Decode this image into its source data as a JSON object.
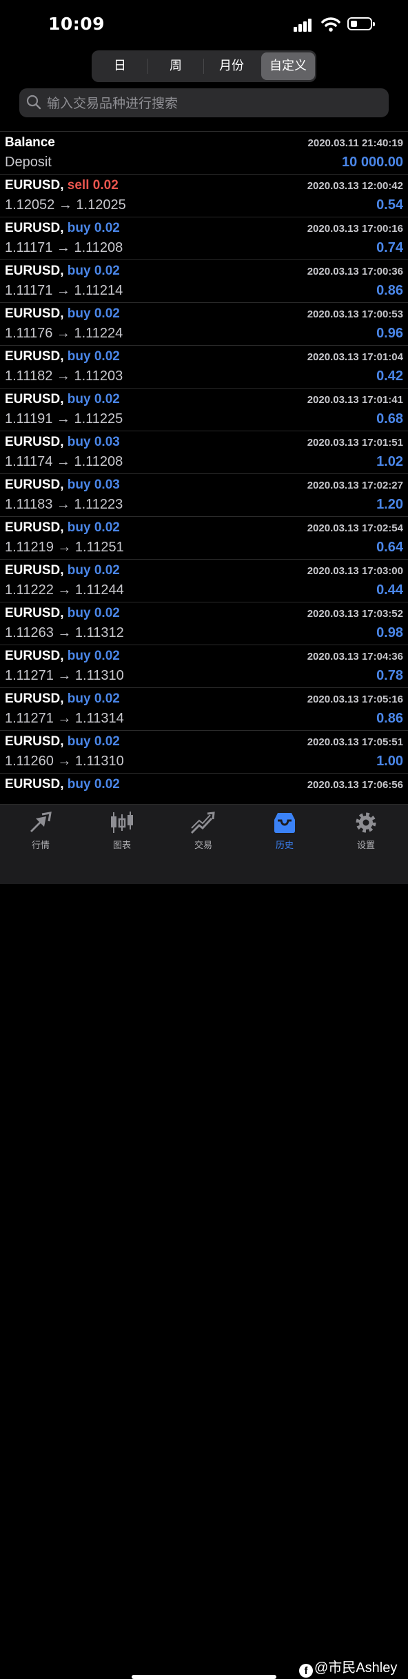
{
  "status_bar": {
    "time": "10:09"
  },
  "periods": {
    "tabs": [
      "日",
      "周",
      "月份",
      "自定义"
    ],
    "selected": "自定义"
  },
  "search": {
    "placeholder": "输入交易品种进行搜索"
  },
  "history": [
    {
      "symbol": "Balance",
      "action": "",
      "volume": "",
      "datetime": "2020.03.11 21:40:19",
      "prices": "Deposit",
      "profit": "10 000.00"
    },
    {
      "symbol": "EURUSD,",
      "action": "sell",
      "volume": "0.02",
      "datetime": "2020.03.13 12:00:42",
      "prices": "1.12052 → 1.12025",
      "profit": "0.54"
    },
    {
      "symbol": "EURUSD,",
      "action": "buy",
      "volume": "0.02",
      "datetime": "2020.03.13 17:00:16",
      "prices": "1.11171 → 1.11208",
      "profit": "0.74"
    },
    {
      "symbol": "EURUSD,",
      "action": "buy",
      "volume": "0.02",
      "datetime": "2020.03.13 17:00:36",
      "prices": "1.11171 → 1.11214",
      "profit": "0.86"
    },
    {
      "symbol": "EURUSD,",
      "action": "buy",
      "volume": "0.02",
      "datetime": "2020.03.13 17:00:53",
      "prices": "1.11176 → 1.11224",
      "profit": "0.96"
    },
    {
      "symbol": "EURUSD,",
      "action": "buy",
      "volume": "0.02",
      "datetime": "2020.03.13 17:01:04",
      "prices": "1.11182 → 1.11203",
      "profit": "0.42"
    },
    {
      "symbol": "EURUSD,",
      "action": "buy",
      "volume": "0.02",
      "datetime": "2020.03.13 17:01:41",
      "prices": "1.11191 → 1.11225",
      "profit": "0.68"
    },
    {
      "symbol": "EURUSD,",
      "action": "buy",
      "volume": "0.03",
      "datetime": "2020.03.13 17:01:51",
      "prices": "1.11174 → 1.11208",
      "profit": "1.02"
    },
    {
      "symbol": "EURUSD,",
      "action": "buy",
      "volume": "0.03",
      "datetime": "2020.03.13 17:02:27",
      "prices": "1.11183 → 1.11223",
      "profit": "1.20"
    },
    {
      "symbol": "EURUSD,",
      "action": "buy",
      "volume": "0.02",
      "datetime": "2020.03.13 17:02:54",
      "prices": "1.11219 → 1.11251",
      "profit": "0.64"
    },
    {
      "symbol": "EURUSD,",
      "action": "buy",
      "volume": "0.02",
      "datetime": "2020.03.13 17:03:00",
      "prices": "1.11222 → 1.11244",
      "profit": "0.44"
    },
    {
      "symbol": "EURUSD,",
      "action": "buy",
      "volume": "0.02",
      "datetime": "2020.03.13 17:03:52",
      "prices": "1.11263 → 1.11312",
      "profit": "0.98"
    },
    {
      "symbol": "EURUSD,",
      "action": "buy",
      "volume": "0.02",
      "datetime": "2020.03.13 17:04:36",
      "prices": "1.11271 → 1.11310",
      "profit": "0.78"
    },
    {
      "symbol": "EURUSD,",
      "action": "buy",
      "volume": "0.02",
      "datetime": "2020.03.13 17:05:16",
      "prices": "1.11271 → 1.11314",
      "profit": "0.86"
    },
    {
      "symbol": "EURUSD,",
      "action": "buy",
      "volume": "0.02",
      "datetime": "2020.03.13 17:05:51",
      "prices": "1.11260 → 1.11310",
      "profit": "1.00"
    },
    {
      "symbol": "EURUSD,",
      "action": "buy",
      "volume": "0.02",
      "datetime": "2020.03.13 17:06:56",
      "prices": "",
      "profit": ""
    }
  ],
  "tabbar": {
    "items": [
      {
        "label": "行情",
        "icon": "quotes-icon"
      },
      {
        "label": "图表",
        "icon": "chart-icon"
      },
      {
        "label": "交易",
        "icon": "trade-icon"
      },
      {
        "label": "历史",
        "icon": "history-icon"
      },
      {
        "label": "设置",
        "icon": "settings-icon"
      }
    ],
    "selected": "历史"
  },
  "watermark": {
    "text": "@市民Ashley"
  },
  "colors": {
    "buy": "#4a86e8",
    "sell": "#e8554e",
    "profit": "#4a86e8",
    "accent": "#3b82f6",
    "background": "#000000"
  }
}
